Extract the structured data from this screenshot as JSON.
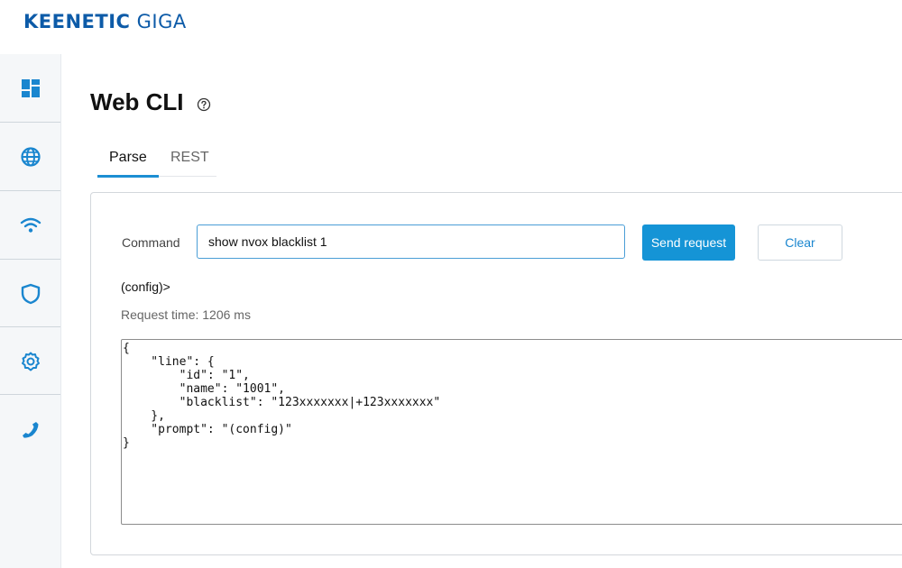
{
  "brand": {
    "primary": "KEENETIC",
    "model": "GIGA",
    "color": "#0d5ba8"
  },
  "sidebar": {
    "items": [
      {
        "icon": "dashboard-icon"
      },
      {
        "icon": "globe-icon"
      },
      {
        "icon": "wifi-icon"
      },
      {
        "icon": "shield-icon"
      },
      {
        "icon": "gear-icon"
      },
      {
        "icon": "phone-icon"
      }
    ],
    "icon_color": "#1a86cf"
  },
  "page": {
    "title": "Web CLI",
    "help_icon": "help-circle-icon"
  },
  "tabs": [
    {
      "label": "Parse",
      "active": true
    },
    {
      "label": "REST",
      "active": false
    }
  ],
  "form": {
    "command_label": "Command",
    "command_value": "show nvox blacklist 1",
    "send_label": "Send request",
    "clear_label": "Clear"
  },
  "result": {
    "prompt": "(config)>",
    "request_time": "Request time: 1206 ms",
    "output": "{\n    \"line\": {\n        \"id\": \"1\",\n        \"name\": \"1001\",\n        \"blacklist\": \"123xxxxxxx|+123xxxxxxx\"\n    },\n    \"prompt\": \"(config)\"\n}"
  },
  "colors": {
    "accent": "#1594d6",
    "tab_underline": "#1c8ed3"
  }
}
